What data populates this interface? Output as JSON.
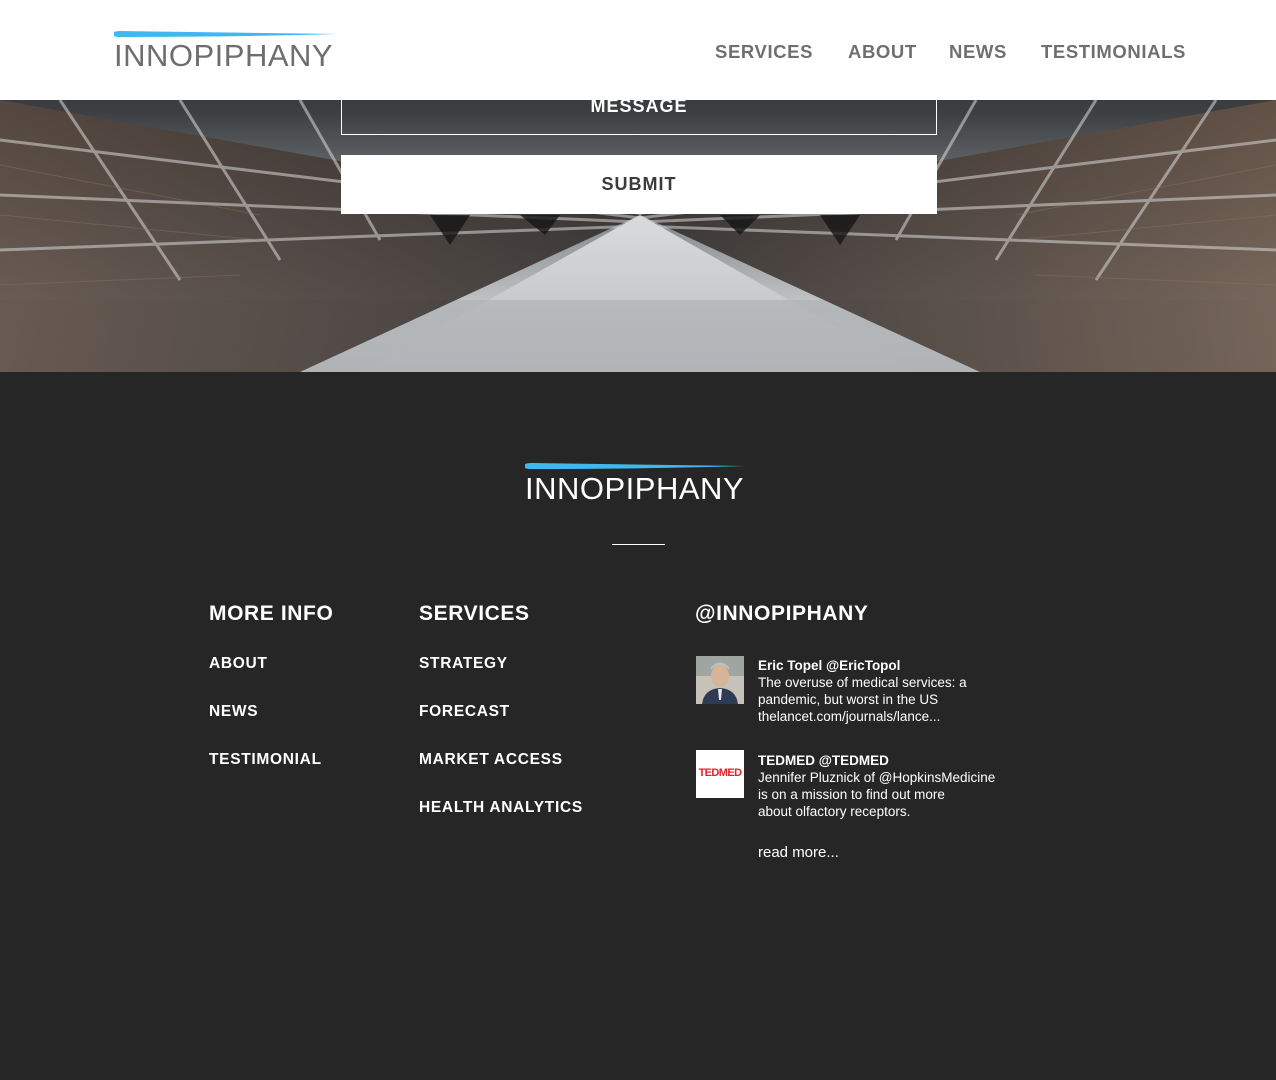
{
  "brand": {
    "name": "INNOPIPHANY",
    "accent_color": "#3fb8f0"
  },
  "nav": {
    "services": "SERVICES",
    "about": "ABOUT",
    "news": "NEWS",
    "testimonials": "TESTIMONIALS"
  },
  "form": {
    "message_label": "MESSAGE",
    "submit_label": "SUBMIT"
  },
  "footer": {
    "more_info": {
      "heading": "MORE INFO",
      "links": [
        "ABOUT",
        "NEWS",
        "TESTIMONIAL"
      ]
    },
    "services": {
      "heading": "SERVICES",
      "links": [
        "STRATEGY",
        "FORECAST",
        "MARKET ACCESS",
        "HEALTH ANALYTICS"
      ]
    },
    "twitter": {
      "heading": "@INNOPIPHANY",
      "tweets": [
        {
          "author": "Eric Topel @EricTopol",
          "lines": [
            "The overuse of medical services: a",
            "pandemic, but worst in the US",
            "thelancet.com/journals/lance..."
          ],
          "avatar_icon": "person-photo-icon"
        },
        {
          "author": "TEDMED @TEDMED",
          "lines": [
            "Jennifer Pluznick of @HopkinsMedicine",
            "is on a mission to find out more",
            "about olfactory receptors."
          ],
          "avatar_icon": "tedmed-logo-icon",
          "avatar_text": "TEDMED"
        }
      ],
      "read_more": "read more..."
    }
  }
}
